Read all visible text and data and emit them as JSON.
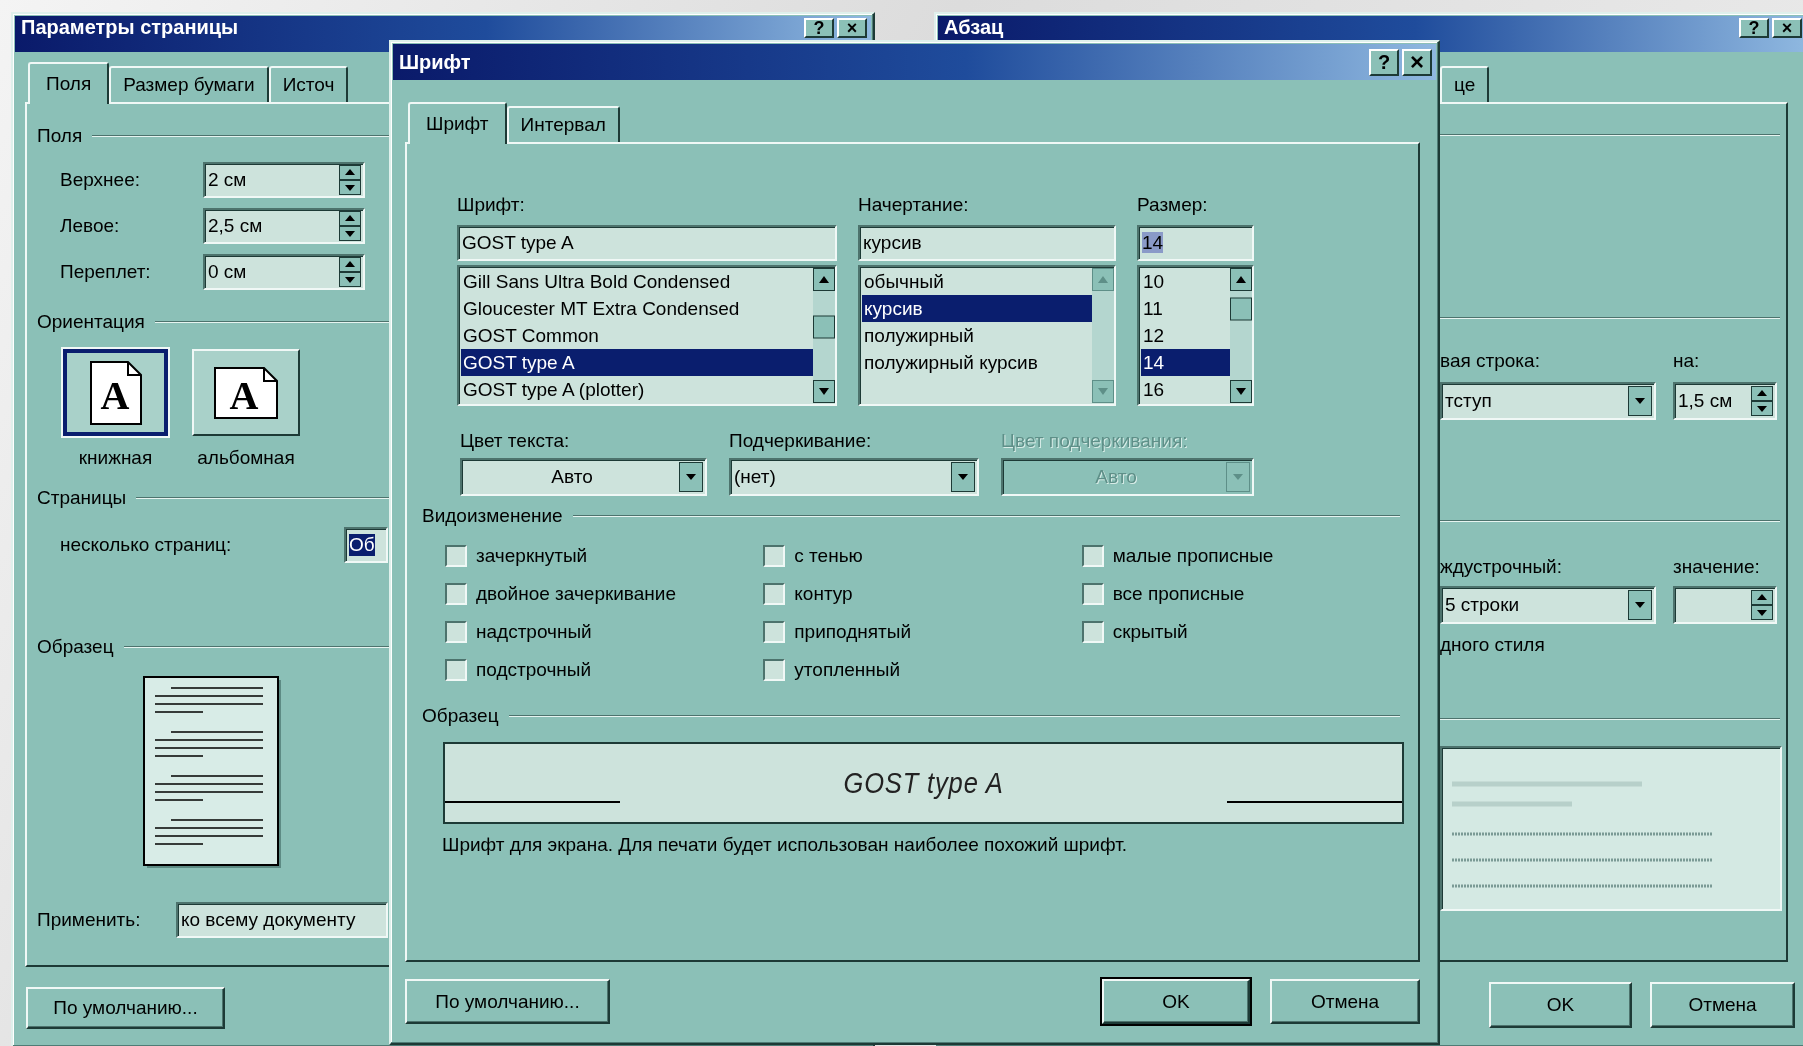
{
  "page_setup_window": {
    "title": "Параметры страницы",
    "title_buttons": [
      {
        "kind": "help",
        "label": "?"
      },
      {
        "kind": "close",
        "label": "×"
      }
    ],
    "tabs": [
      {
        "label": "Поля",
        "selected": true
      },
      {
        "label": "Размер бумаги",
        "selected": false
      },
      {
        "label": "Источ",
        "selected": false
      }
    ],
    "margins": {
      "title": "Поля",
      "fields": [
        {
          "label": "Верхнее:",
          "value": "2 см"
        },
        {
          "label": "Левое:",
          "value": "2,5 см"
        },
        {
          "label": "Переплет:",
          "value": "0 см"
        }
      ]
    },
    "orientation": {
      "title": "Ориентация",
      "options": [
        {
          "label": "книжная",
          "icon_letter": "A",
          "selected": true
        },
        {
          "label": "альбомная",
          "icon_letter": "A",
          "selected": false
        }
      ]
    },
    "pages": {
      "title": "Страницы",
      "label": "несколько страниц:",
      "value": "Об",
      "value_selected": true
    },
    "sample": {
      "title": "Образец"
    },
    "apply": {
      "label": "Применить:",
      "value": "ко всему документу"
    },
    "default_button": "По умолчанию..."
  },
  "font_window": {
    "title": "Шрифт",
    "title_buttons": [
      {
        "kind": "help",
        "label": "?"
      },
      {
        "kind": "close",
        "label": "×"
      }
    ],
    "tabs": [
      {
        "label": "Шрифт",
        "selected": true
      },
      {
        "label": "Интервал",
        "selected": false
      }
    ],
    "font": {
      "label": "Шрифт:",
      "value": "GOST type A",
      "items": [
        {
          "label": "Gill Sans Ultra Bold Condensed",
          "selected": false
        },
        {
          "label": "Gloucester MT Extra Condensed",
          "selected": false
        },
        {
          "label": "GOST Common",
          "selected": false
        },
        {
          "label": "GOST type A",
          "selected": true
        },
        {
          "label": "GOST type A (plotter)",
          "selected": false
        }
      ]
    },
    "style": {
      "label": "Начертание:",
      "value": "курсив",
      "items": [
        {
          "label": "обычный",
          "selected": false
        },
        {
          "label": "курсив",
          "selected": true
        },
        {
          "label": "полужирный",
          "selected": false
        },
        {
          "label": "полужирный курсив",
          "selected": false
        }
      ]
    },
    "size": {
      "label": "Размер:",
      "value": "14",
      "value_selected": true,
      "items": [
        {
          "label": "10",
          "selected": false
        },
        {
          "label": "11",
          "selected": false
        },
        {
          "label": "12",
          "selected": false
        },
        {
          "label": "14",
          "selected": true
        },
        {
          "label": "16",
          "selected": false
        }
      ]
    },
    "dropdowns": [
      {
        "label": "Цвет текста:",
        "value": "Авто",
        "disabled": false
      },
      {
        "label": "Подчеркивание:",
        "value": "(нет)",
        "disabled": false
      },
      {
        "label": "Цвет подчеркивания:",
        "value": "Авто",
        "disabled": true
      }
    ],
    "effects": {
      "title": "Видоизменение",
      "columns": [
        [
          {
            "label": "зачеркнутый",
            "checked": false
          },
          {
            "label": "двойное зачеркивание",
            "checked": false
          },
          {
            "label": "надстрочный",
            "checked": false
          },
          {
            "label": "подстрочный",
            "checked": false
          }
        ],
        [
          {
            "label": "с тенью",
            "checked": false
          },
          {
            "label": "контур",
            "checked": false
          },
          {
            "label": "приподнятый",
            "checked": false
          },
          {
            "label": "утопленный",
            "checked": false
          }
        ],
        [
          {
            "label": "малые прописные",
            "checked": false
          },
          {
            "label": "все прописные",
            "checked": false
          },
          {
            "label": "скрытый",
            "checked": false
          }
        ]
      ]
    },
    "preview": {
      "title": "Образец",
      "sample": "GOST type A",
      "note": "Шрифт для экрана. Для печати будет использован наиболее похожий шрифт."
    },
    "buttons": {
      "default": "По умолчанию...",
      "ok": "OK",
      "cancel": "Отмена"
    }
  },
  "paragraph_window": {
    "title": "Абзац",
    "title_buttons": [
      {
        "kind": "help",
        "label": "?"
      },
      {
        "kind": "close",
        "label": "×"
      }
    ],
    "tabs": [
      {
        "label": "це",
        "selected": false
      }
    ],
    "first_line": {
      "label": "вая строка:",
      "value": "тступ"
    },
    "indent_by": {
      "label": "на:",
      "value": "1,5 см"
    },
    "line_spacing": {
      "label": "ждустрочный:",
      "value": "5 строки"
    },
    "spacing_value": {
      "label": "значение:"
    },
    "style_note": "дного стиля",
    "buttons": {
      "ok": "OK",
      "cancel": "Отмена"
    }
  }
}
